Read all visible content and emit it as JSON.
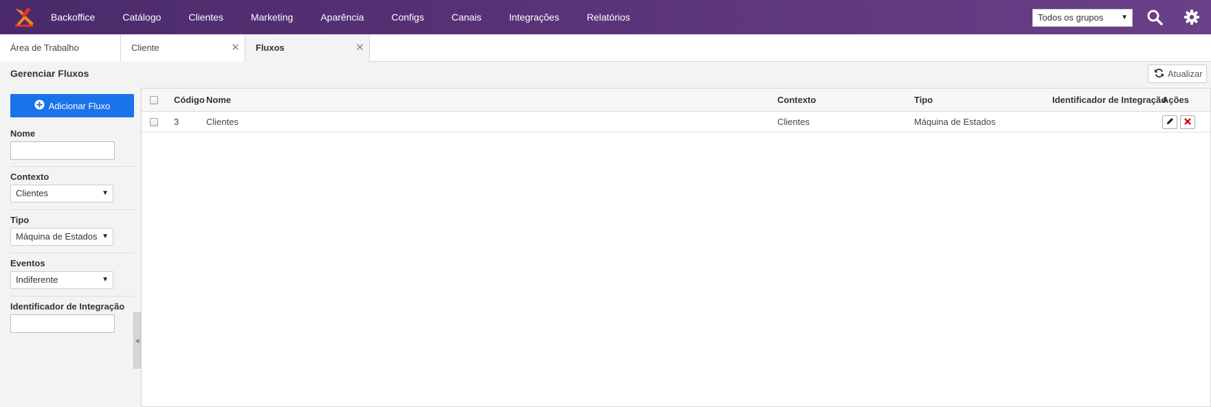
{
  "nav": {
    "items": [
      "Backoffice",
      "Catálogo",
      "Clientes",
      "Marketing",
      "Aparência",
      "Configs",
      "Canais",
      "Integrações",
      "Relatórios"
    ],
    "group_select": "Todos os grupos"
  },
  "tabs": [
    {
      "label": "Área de Trabalho"
    },
    {
      "label": "Cliente"
    },
    {
      "label": "Fluxos"
    }
  ],
  "page": {
    "title": "Gerenciar Fluxos",
    "refresh_label": "Atualizar"
  },
  "sidebar": {
    "add_label": "Adicionar Fluxo",
    "nome_label": "Nome",
    "nome_value": "",
    "contexto_label": "Contexto",
    "contexto_value": "Clientes",
    "tipo_label": "Tipo",
    "tipo_value": "Máquina de Estados",
    "eventos_label": "Eventos",
    "eventos_value": "Indiferente",
    "integracao_label": "Identificador de Integração",
    "integracao_value": ""
  },
  "grid": {
    "columns": [
      "Código",
      "Nome",
      "Contexto",
      "Tipo",
      "Identificador de Integração",
      "Ações"
    ],
    "rows": [
      {
        "codigo": "3",
        "nome": "Clientes",
        "contexto": "Clientes",
        "tipo": "Máquina de Estados",
        "integracao": ""
      }
    ]
  },
  "colors": {
    "topbar": "#5a3478",
    "primary_button": "#1a73e8",
    "delete_icon": "#cc0000",
    "logo_red": "#e0332c",
    "logo_orange": "#f58220"
  }
}
